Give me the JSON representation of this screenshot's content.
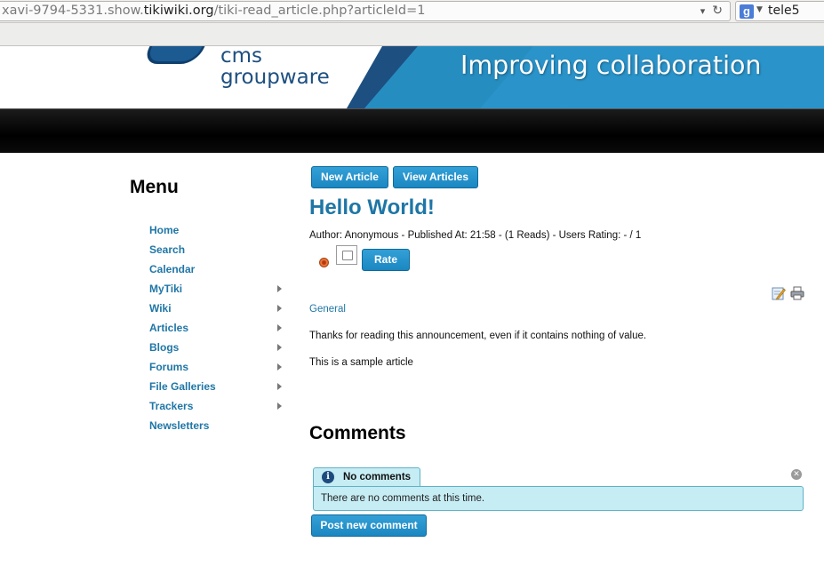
{
  "browser": {
    "url_prefix": "xavi-9794-5331.show.",
    "url_domain": "tikiwiki.org",
    "url_path": "/tiki-read_article.php?articleId=1",
    "search_text": "tele5",
    "search_engine_letter": "g"
  },
  "banner": {
    "logo_line1": "cms",
    "logo_line2": "groupware",
    "tagline": "Improving collaboration",
    "colors": {
      "blue": "#2a93c9",
      "dark_navy": "#1d4f80"
    }
  },
  "sidebar": {
    "title": "Menu",
    "items": [
      {
        "label": "Home",
        "has_submenu": false
      },
      {
        "label": "Search",
        "has_submenu": false
      },
      {
        "label": "Calendar",
        "has_submenu": false
      },
      {
        "label": "MyTiki",
        "has_submenu": true
      },
      {
        "label": "Wiki",
        "has_submenu": true
      },
      {
        "label": "Articles",
        "has_submenu": true
      },
      {
        "label": "Blogs",
        "has_submenu": true
      },
      {
        "label": "Forums",
        "has_submenu": true
      },
      {
        "label": "File Galleries",
        "has_submenu": true
      },
      {
        "label": "Trackers",
        "has_submenu": true
      },
      {
        "label": "Newsletters",
        "has_submenu": false
      }
    ]
  },
  "main": {
    "new_article_label": "New Article",
    "view_articles_label": "View Articles",
    "title": "Hello World!",
    "meta": "Author: Anonymous - Published At: 21:58 - (1 Reads) - Users Rating: - / 1",
    "rate_label": "Rate",
    "category": "General",
    "paragraphs": [
      "Thanks for reading this announcement, even if it contains nothing of value.",
      "This is a sample article"
    ],
    "icons": [
      "edit-icon",
      "print-icon"
    ]
  },
  "comments": {
    "title": "Comments",
    "tab_label": "No comments",
    "message": "There are no comments at this time.",
    "post_label": "Post new comment"
  },
  "theme": {
    "link": "#1f76a6",
    "button": "#2491cc",
    "info_bg": "#c6ecf4"
  }
}
